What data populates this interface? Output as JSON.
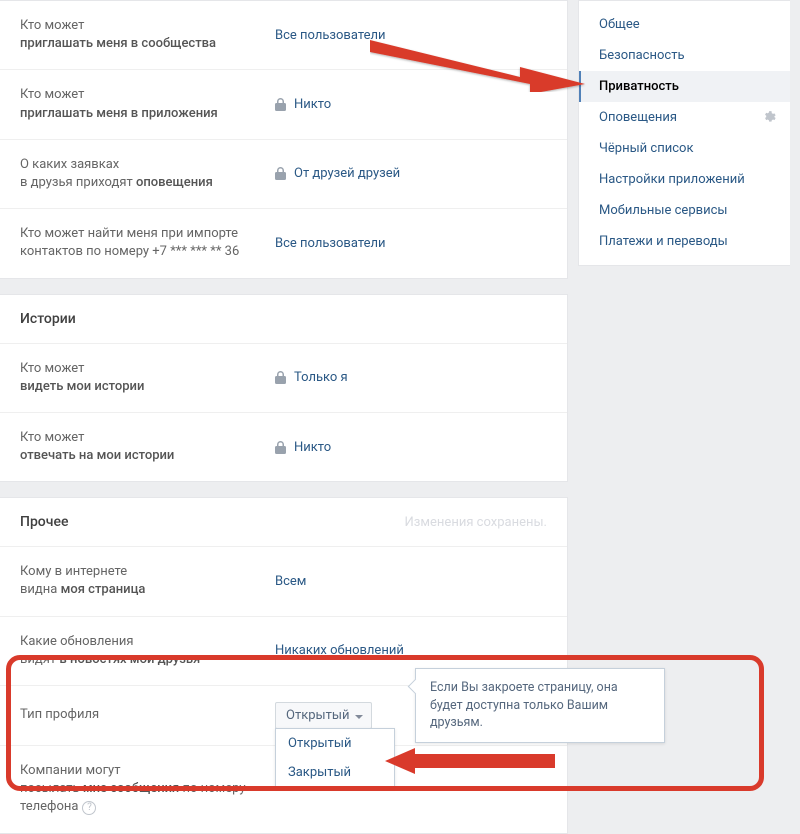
{
  "sidebar": {
    "items": [
      {
        "label": "Общее"
      },
      {
        "label": "Безопасность"
      },
      {
        "label": "Приватность"
      },
      {
        "label": "Оповещения"
      },
      {
        "label": "Чёрный список"
      },
      {
        "label": "Настройки приложений"
      },
      {
        "label": "Мобильные сервисы"
      },
      {
        "label": "Платежи и переводы"
      }
    ],
    "active_index": 2
  },
  "top_rows": [
    {
      "label_pre": "Кто может",
      "label_bold": "приглашать меня в сообщества",
      "value": "Все пользователи",
      "locked": false
    },
    {
      "label_pre": "Кто может",
      "label_bold": "приглашать меня в приложения",
      "value": "Никто",
      "locked": true
    },
    {
      "label_pre": "О каких заявках",
      "label_mid": "в друзья приходят ",
      "label_bold": "оповещения",
      "value": "От друзей друзей",
      "locked": true
    },
    {
      "label_pre": "Кто может найти меня при импорте",
      "label_mid": "контактов по номеру +7 *** *** ** 36",
      "value": "Все пользователи",
      "locked": false
    }
  ],
  "stories": {
    "header": "Истории",
    "rows": [
      {
        "label_pre": "Кто может",
        "label_bold": "видеть мои истории",
        "value": "Только я",
        "locked": true
      },
      {
        "label_pre": "Кто может",
        "label_bold": "отвечать на мои истории",
        "value": "Никто",
        "locked": true
      }
    ]
  },
  "other": {
    "header": "Прочее",
    "saved_text": "Изменения сохранены.",
    "rows": {
      "r0": {
        "label_pre": "Кому в интернете",
        "label_mid": "видна ",
        "label_bold": "моя страница",
        "value": "Всем"
      },
      "r1": {
        "label_pre": "Какие обновления",
        "label_mid": "видят ",
        "label_bold": "в новостях мои друзья",
        "value": "Никаких обновлений"
      },
      "profile_type": {
        "label": "Тип профиля",
        "selected": "Открытый",
        "options": [
          "Открытый",
          "Закрытый"
        ],
        "tooltip": "Если Вы закроете страницу, она будет доступна только Вашим друзьям."
      },
      "companies": {
        "label_pre": "Компании могут",
        "label_mid": "посылать ",
        "label_bold": "мне сообщения",
        "label_post": " по номеру",
        "label_next": "телефона"
      }
    }
  }
}
